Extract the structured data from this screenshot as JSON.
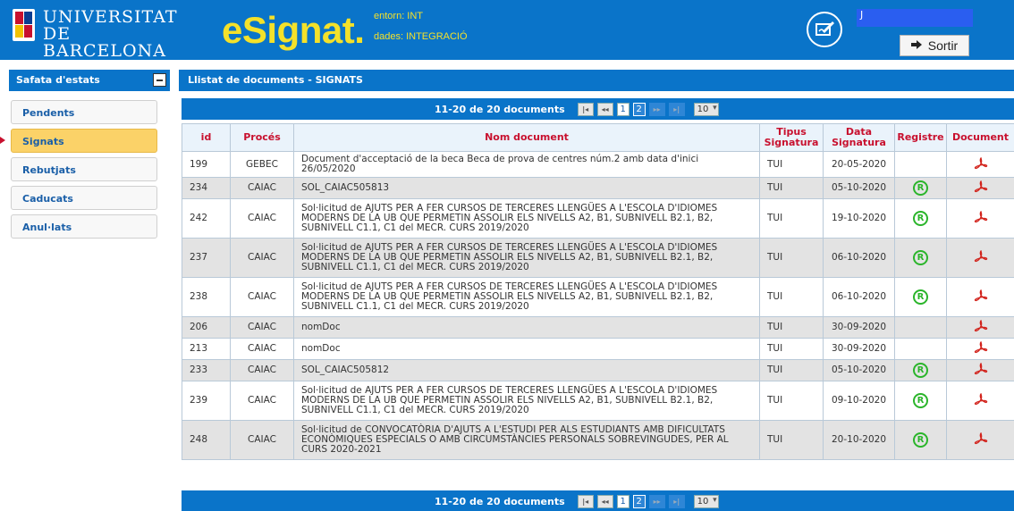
{
  "header": {
    "university_line1": "UNIVERSITAT DE",
    "university_line2": "BARCELONA",
    "brand": "eSignat.",
    "env_label": "entorn: INT",
    "data_label": "dades: INTEGRACIÓ",
    "user_name": "J",
    "logout_label": "Sortir",
    "logout_icon": "logout-arrow-icon",
    "sign_icon": "signature-pen-icon"
  },
  "sidebar": {
    "title": "Safata d'estats",
    "items": [
      {
        "label": "Pendents"
      },
      {
        "label": "Signats"
      },
      {
        "label": "Rebutjats"
      },
      {
        "label": "Caducats"
      },
      {
        "label": "Anul·lats"
      }
    ],
    "active_index": 1
  },
  "main": {
    "title": "Llistat de documents - SIGNATS",
    "pager": {
      "summary": "11-20 de 20 documents",
      "first": "|◂",
      "prev": "◂◂",
      "next": "▸▸",
      "last": "▸|",
      "pages": [
        "1",
        "2"
      ],
      "current_page": "2",
      "per_page": "10"
    },
    "columns": [
      "id",
      "Procés",
      "Nom document",
      "Tipus Signatura",
      "Data Signatura",
      "Registre",
      "Document"
    ],
    "rows": [
      {
        "id": "199",
        "proces": "GEBEC",
        "nom": "Document d'acceptació de la beca Beca de prova de centres núm.2 amb data d'inici 26/05/2020",
        "tipus": "TUI",
        "data": "20-05-2020",
        "registre": false
      },
      {
        "id": "234",
        "proces": "CAIAC",
        "nom": "SOL_CAIAC505813",
        "tipus": "TUI",
        "data": "05-10-2020",
        "registre": true
      },
      {
        "id": "242",
        "proces": "CAIAC",
        "nom": "Sol·licitud de AJUTS PER A FER CURSOS DE TERCERES LLENGÜES A L'ESCOLA D'IDIOMES MODERNS DE LA UB QUE PERMETIN ASSOLIR ELS NIVELLS A2, B1, SUBNIVELL B2.1, B2, SUBNIVELL C1.1, C1 del MECR. CURS 2019/2020",
        "tipus": "TUI",
        "data": "19-10-2020",
        "registre": true
      },
      {
        "id": "237",
        "proces": "CAIAC",
        "nom": "Sol·licitud de AJUTS PER A FER CURSOS DE TERCERES LLENGÜES A L'ESCOLA D'IDIOMES MODERNS DE LA UB QUE PERMETIN ASSOLIR ELS NIVELLS A2, B1, SUBNIVELL B2.1, B2, SUBNIVELL C1.1, C1 del MECR. CURS 2019/2020",
        "tipus": "TUI",
        "data": "06-10-2020",
        "registre": true
      },
      {
        "id": "238",
        "proces": "CAIAC",
        "nom": "Sol·licitud de AJUTS PER A FER CURSOS DE TERCERES LLENGÜES A L'ESCOLA D'IDIOMES MODERNS DE LA UB QUE PERMETIN ASSOLIR ELS NIVELLS A2, B1, SUBNIVELL B2.1, B2, SUBNIVELL C1.1, C1 del MECR. CURS 2019/2020",
        "tipus": "TUI",
        "data": "06-10-2020",
        "registre": true
      },
      {
        "id": "206",
        "proces": "CAIAC",
        "nom": "nomDoc",
        "tipus": "TUI",
        "data": "30-09-2020",
        "registre": false
      },
      {
        "id": "213",
        "proces": "CAIAC",
        "nom": "nomDoc",
        "tipus": "TUI",
        "data": "30-09-2020",
        "registre": false
      },
      {
        "id": "233",
        "proces": "CAIAC",
        "nom": "SOL_CAIAC505812",
        "tipus": "TUI",
        "data": "05-10-2020",
        "registre": true
      },
      {
        "id": "239",
        "proces": "CAIAC",
        "nom": "Sol·licitud de AJUTS PER A FER CURSOS DE TERCERES LLENGÜES A L'ESCOLA D'IDIOMES MODERNS DE LA UB QUE PERMETIN ASSOLIR ELS NIVELLS A2, B1, SUBNIVELL B2.1, B2, SUBNIVELL C1.1, C1 del MECR. CURS 2019/2020",
        "tipus": "TUI",
        "data": "09-10-2020",
        "registre": true
      },
      {
        "id": "248",
        "proces": "CAIAC",
        "nom": "Sol·licitud de CONVOCATÒRIA D'AJUTS A L'ESTUDI PER ALS ESTUDIANTS AMB DIFICULTATS ECONÒMIQUES ESPECIALS O AMB CIRCUMSTÀNCIES PERSONALS SOBREVINGUDES, PER AL CURS 2020-2021",
        "tipus": "TUI",
        "data": "20-10-2020",
        "registre": true
      }
    ],
    "registre_icon": "registered-icon",
    "registre_symbol": "R",
    "document_icon": "pdf-icon"
  },
  "colors": {
    "header_blue": "#0a74c9",
    "brand_yellow": "#f4e12a",
    "header_red": "#c8102e",
    "active_item": "#fbd268",
    "registre_green": "#2bb52b",
    "pdf_red": "#d2231c"
  }
}
